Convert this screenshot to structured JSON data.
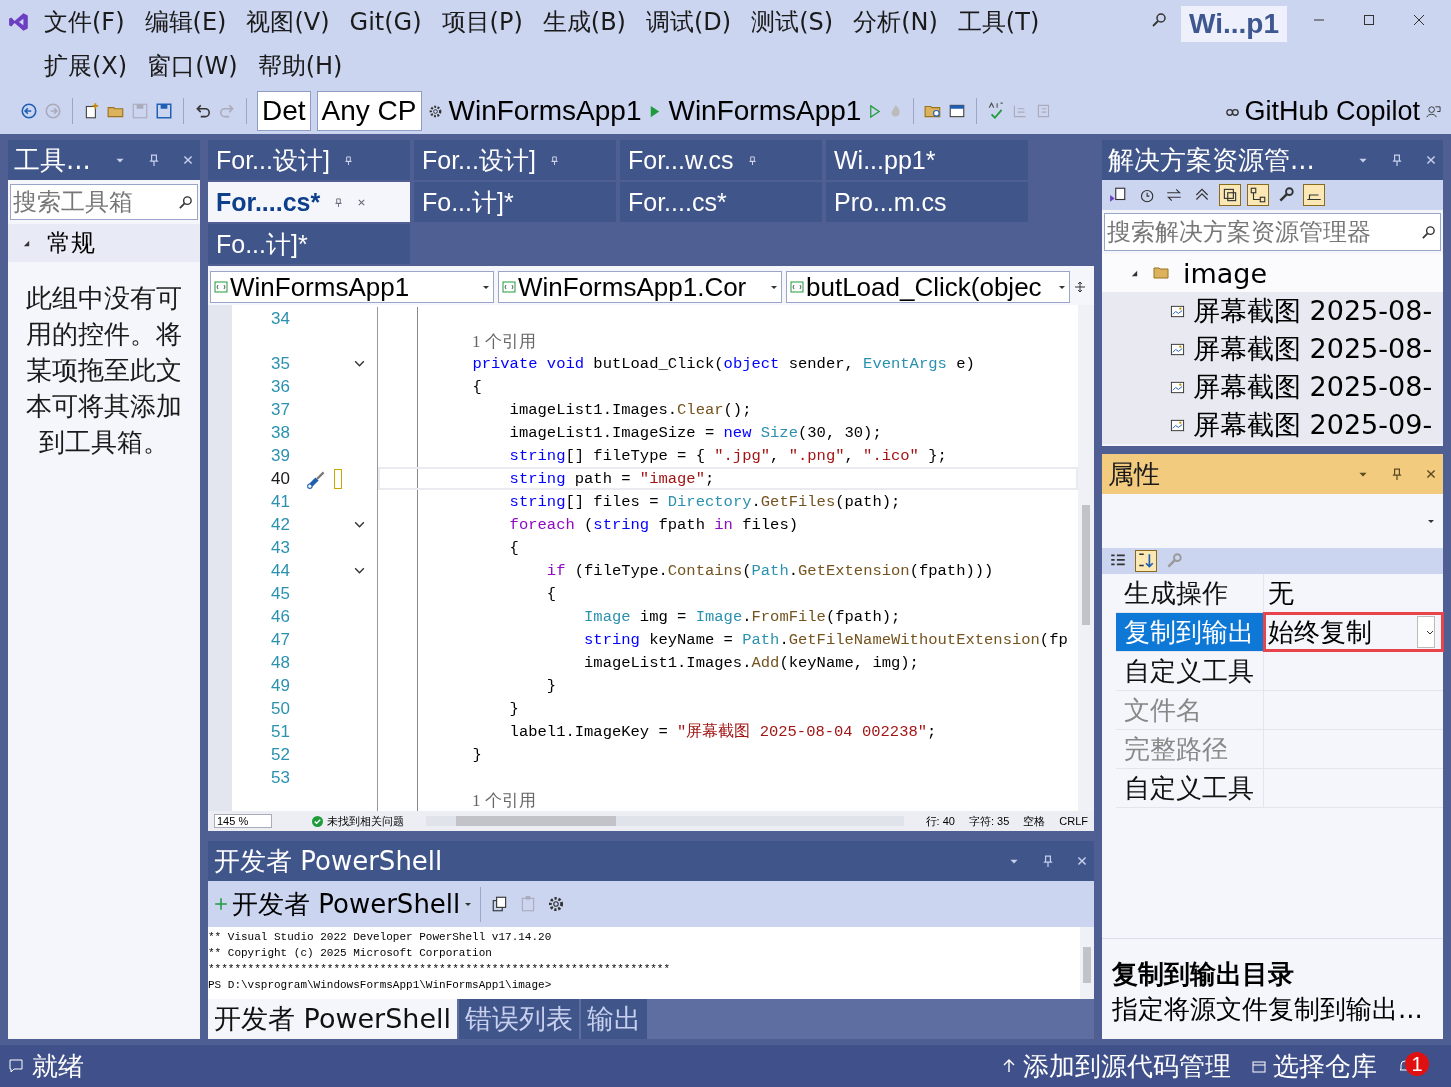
{
  "title_badge": "Wi...p1",
  "menu_rows": [
    [
      "文件(F)",
      "编辑(E)",
      "视图(V)",
      "Git(G)",
      "项目(P)",
      "生成(B)",
      "调试(D)",
      "测试(S)",
      "分析(N)",
      "工具(T)"
    ],
    [
      "扩展(X)",
      "窗口(W)",
      "帮助(H)"
    ]
  ],
  "toolbar": {
    "configuration": "Det",
    "platform": "Any CP",
    "startup_project": "WinFormsApp1",
    "run_target": "WinFormsApp1",
    "copilot": "GitHub Copilot"
  },
  "toolbox": {
    "title": "工具...",
    "search_placeholder": "搜索工具箱",
    "group": {
      "label": "常规",
      "expanded": true
    },
    "empty_message": "此组中没有可用的控件。将某项拖至此文本可将其添加到工具箱。"
  },
  "document_tabs": [
    [
      {
        "label": "For...设计]",
        "selected": false,
        "pinned": true
      },
      {
        "label": "For...设计]",
        "selected": false,
        "pinned": true
      },
      {
        "label": "For...w.cs",
        "selected": false,
        "pinned": true
      },
      {
        "label": "Wi...pp1*",
        "selected": false,
        "pinned": false
      }
    ],
    [
      {
        "label": "For....cs*",
        "selected": true,
        "pinned": true
      },
      {
        "label": "Fo...计]*",
        "selected": false,
        "pinned": false
      },
      {
        "label": "For....cs*",
        "selected": false,
        "pinned": false
      },
      {
        "label": "Pro...m.cs",
        "selected": false,
        "pinned": false
      }
    ],
    [
      {
        "label": "Fo...计]*",
        "selected": false,
        "pinned": false
      }
    ]
  ],
  "navigation": [
    "WinFormsApp1",
    "WinFormsApp1.Cor",
    "butLoad_Click(objec"
  ],
  "code_lines": [
    {
      "kind": "code",
      "num": "34",
      "fold": false,
      "current": false
    },
    {
      "kind": "codelens",
      "text": "1 个引用"
    },
    {
      "kind": "code",
      "num": "35",
      "fold": true,
      "current": false,
      "tokens": [
        {
          "kind": "kw",
          "t": "        private void "
        },
        {
          "kind": "p",
          "t": "butLoad_Click("
        },
        {
          "kind": "kw",
          "t": "object"
        },
        {
          "kind": "p",
          "t": " sender, "
        },
        {
          "kind": "type",
          "t": "EventArgs"
        },
        {
          "kind": "p",
          "t": " e)"
        }
      ]
    },
    {
      "kind": "code",
      "num": "36",
      "fold": false,
      "current": false,
      "tokens": [
        {
          "kind": "p",
          "t": "        {"
        }
      ]
    },
    {
      "kind": "code",
      "num": "37",
      "fold": false,
      "current": false,
      "tokens": [
        {
          "kind": "p",
          "t": "            imageList1.Images."
        },
        {
          "kind": "m",
          "t": "Clear"
        },
        {
          "kind": "p",
          "t": "();"
        }
      ]
    },
    {
      "kind": "code",
      "num": "38",
      "fold": false,
      "current": false,
      "tokens": [
        {
          "kind": "p",
          "t": "            imageList1.ImageSize = "
        },
        {
          "kind": "kw",
          "t": "new"
        },
        {
          "kind": "type",
          "t": " Size"
        },
        {
          "kind": "p",
          "t": "(30, 30);"
        }
      ]
    },
    {
      "kind": "code",
      "num": "39",
      "fold": false,
      "current": false,
      "tokens": [
        {
          "kind": "kw",
          "t": "            string"
        },
        {
          "kind": "p",
          "t": "[] fileType = { "
        },
        {
          "kind": "str",
          "t": "\".jpg\""
        },
        {
          "kind": "p",
          "t": ", "
        },
        {
          "kind": "str",
          "t": "\".png\""
        },
        {
          "kind": "p",
          "t": ", "
        },
        {
          "kind": "str",
          "t": "\".ico\""
        },
        {
          "kind": "p",
          "t": " };"
        }
      ]
    },
    {
      "kind": "code",
      "num": "40",
      "fold": false,
      "current": true,
      "tokens": [
        {
          "kind": "kw",
          "t": "            string"
        },
        {
          "kind": "p",
          "t": " path = "
        },
        {
          "kind": "str",
          "t": "\"image\""
        },
        {
          "kind": "p",
          "t": ";"
        }
      ]
    },
    {
      "kind": "code",
      "num": "41",
      "fold": false,
      "current": false,
      "tokens": [
        {
          "kind": "kw",
          "t": "            string"
        },
        {
          "kind": "p",
          "t": "[] files = "
        },
        {
          "kind": "type",
          "t": "Directory"
        },
        {
          "kind": "p",
          "t": "."
        },
        {
          "kind": "m",
          "t": "GetFiles"
        },
        {
          "kind": "p",
          "t": "(path);"
        }
      ]
    },
    {
      "kind": "code",
      "num": "42",
      "fold": true,
      "current": false,
      "tokens": [
        {
          "kind": "ctl",
          "t": "            foreach"
        },
        {
          "kind": "p",
          "t": " ("
        },
        {
          "kind": "kw",
          "t": "string"
        },
        {
          "kind": "p",
          "t": " fpath "
        },
        {
          "kind": "ctl",
          "t": "in"
        },
        {
          "kind": "p",
          "t": " files)"
        }
      ]
    },
    {
      "kind": "code",
      "num": "43",
      "fold": false,
      "current": false,
      "tokens": [
        {
          "kind": "p",
          "t": "            {"
        }
      ]
    },
    {
      "kind": "code",
      "num": "44",
      "fold": true,
      "current": false,
      "tokens": [
        {
          "kind": "ctl",
          "t": "                if"
        },
        {
          "kind": "p",
          "t": " (fileType."
        },
        {
          "kind": "m",
          "t": "Contains"
        },
        {
          "kind": "p",
          "t": "("
        },
        {
          "kind": "type",
          "t": "Path"
        },
        {
          "kind": "p",
          "t": "."
        },
        {
          "kind": "m",
          "t": "GetExtension"
        },
        {
          "kind": "p",
          "t": "(fpath)))"
        }
      ]
    },
    {
      "kind": "code",
      "num": "45",
      "fold": false,
      "current": false,
      "tokens": [
        {
          "kind": "p",
          "t": "                {"
        }
      ]
    },
    {
      "kind": "code",
      "num": "46",
      "fold": false,
      "current": false,
      "tokens": [
        {
          "kind": "type",
          "t": "                    Image"
        },
        {
          "kind": "p",
          "t": " img = "
        },
        {
          "kind": "type",
          "t": "Image"
        },
        {
          "kind": "p",
          "t": "."
        },
        {
          "kind": "m",
          "t": "FromFile"
        },
        {
          "kind": "p",
          "t": "(fpath);"
        }
      ]
    },
    {
      "kind": "code",
      "num": "47",
      "fold": false,
      "current": false,
      "tokens": [
        {
          "kind": "kw",
          "t": "                    string"
        },
        {
          "kind": "p",
          "t": " keyName = "
        },
        {
          "kind": "type",
          "t": "Path"
        },
        {
          "kind": "p",
          "t": "."
        },
        {
          "kind": "m",
          "t": "GetFileNameWithoutExtension"
        },
        {
          "kind": "p",
          "t": "(fp"
        }
      ]
    },
    {
      "kind": "code",
      "num": "48",
      "fold": false,
      "current": false,
      "tokens": [
        {
          "kind": "p",
          "t": "                    imageList1.Images."
        },
        {
          "kind": "m",
          "t": "Add"
        },
        {
          "kind": "p",
          "t": "(keyName, img);"
        }
      ]
    },
    {
      "kind": "code",
      "num": "49",
      "fold": false,
      "current": false,
      "tokens": [
        {
          "kind": "p",
          "t": "                }"
        }
      ]
    },
    {
      "kind": "code",
      "num": "50",
      "fold": false,
      "current": false,
      "tokens": [
        {
          "kind": "p",
          "t": "            }"
        }
      ]
    },
    {
      "kind": "code",
      "num": "51",
      "fold": false,
      "current": false,
      "tokens": [
        {
          "kind": "p",
          "t": "            label1.ImageKey = "
        },
        {
          "kind": "str",
          "t": "\"屏幕截图 2025-08-04 002238\""
        },
        {
          "kind": "p",
          "t": ";"
        }
      ]
    },
    {
      "kind": "code",
      "num": "52",
      "fold": false,
      "current": false,
      "tokens": [
        {
          "kind": "p",
          "t": "        }"
        }
      ]
    },
    {
      "kind": "code",
      "num": "53",
      "fold": false,
      "current": false
    },
    {
      "kind": "codelens",
      "text": "1 个引用"
    }
  ],
  "editor_status": {
    "zoom": "145 %",
    "issues": "未找到相关问题",
    "line": "行: 40",
    "char": "字符: 35",
    "indent": "空格",
    "line_ending": "CRLF"
  },
  "powershell": {
    "title": "开发者 PowerShell",
    "terminal_tab": "开发者 PowerShell",
    "output": [
      "** Visual Studio 2022 Developer PowerShell v17.14.20",
      "** Copyright (c) 2025 Microsoft Corporation",
      "**********************************************************************",
      "PS D:\\vsprogram\\WindowsFormsApp1\\WinFormsApp1\\image>"
    ]
  },
  "bottom_tabs": [
    {
      "label": "开发者 PowerShell",
      "selected": true
    },
    {
      "label": "错误列表",
      "selected": false
    },
    {
      "label": "输出",
      "selected": false
    }
  ],
  "solution_explorer": {
    "title": "解决方案资源管...",
    "search_placeholder": "搜索解决方案资源管理器",
    "tree": [
      {
        "label": "image",
        "expanded": true,
        "children": [
          {
            "label": "屏幕截图 2025-08-"
          },
          {
            "label": "屏幕截图 2025-08-"
          },
          {
            "label": "屏幕截图 2025-08-"
          },
          {
            "label": "屏幕截图 2025-09-"
          }
        ]
      }
    ]
  },
  "properties": {
    "title": "属性",
    "rows": [
      {
        "name": "生成操作",
        "value": "无",
        "selected": false,
        "disabled": false,
        "dropdown": false,
        "highlighted": false
      },
      {
        "name": "复制到输出",
        "value": "始终复制",
        "selected": true,
        "disabled": false,
        "dropdown": true,
        "highlighted": true
      },
      {
        "name": "自定义工具",
        "selected": false,
        "disabled": false,
        "dropdown": false,
        "highlighted": false
      },
      {
        "name": "文件名",
        "selected": false,
        "disabled": true,
        "dropdown": false,
        "highlighted": false
      },
      {
        "name": "完整路径",
        "selected": false,
        "disabled": true,
        "dropdown": false,
        "highlighted": false
      },
      {
        "name": "自定义工具",
        "selected": false,
        "disabled": false,
        "dropdown": false,
        "highlighted": false
      }
    ],
    "description_title": "复制到输出目录",
    "description": "指定将源文件复制到输出..."
  },
  "status_bar": {
    "text": "就绪",
    "source_control": "添加到源代码管理",
    "repository": "选择仓库",
    "notifications": "1"
  }
}
